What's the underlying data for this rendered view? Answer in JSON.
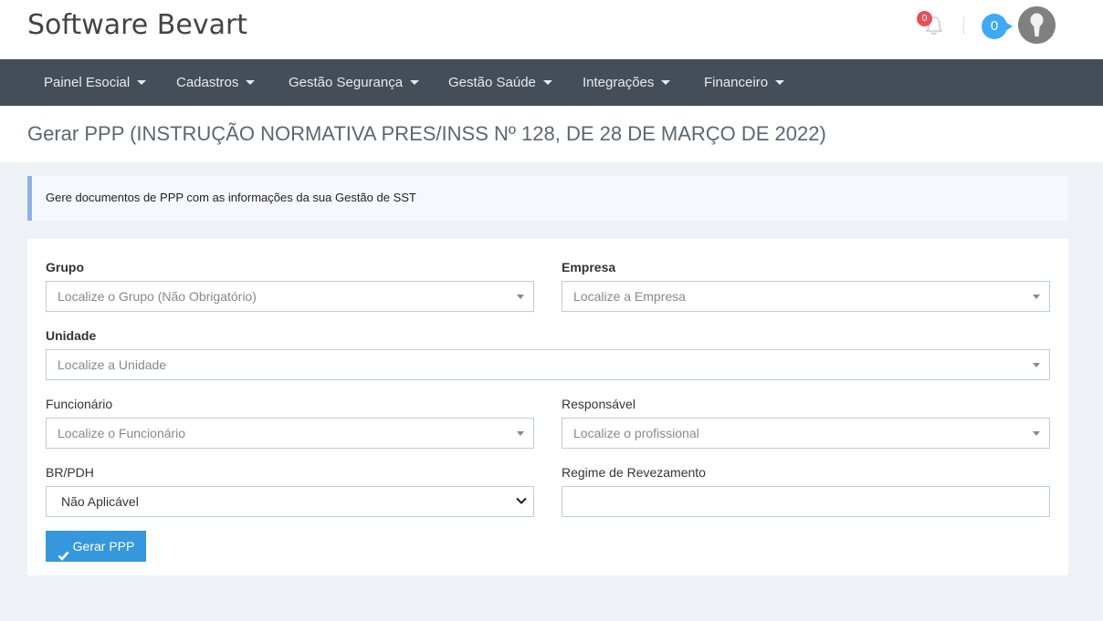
{
  "header": {
    "brand": "Software Bevart",
    "notifications_count": "0",
    "messages_count": "0"
  },
  "nav": {
    "items": [
      {
        "label": "Painel Esocial"
      },
      {
        "label": "Cadastros"
      },
      {
        "label": "Gestão Segurança"
      },
      {
        "label": "Gestão Saúde"
      },
      {
        "label": "Integrações"
      },
      {
        "label": "Financeiro"
      }
    ]
  },
  "page": {
    "title": "Gerar PPP (INSTRUÇÃO NORMATIVA PRES/INSS Nº 128, DE 28 DE MARÇO DE 2022)",
    "note": "Gere documentos de PPP com as informações da sua Gestão de SST"
  },
  "form": {
    "grupo": {
      "label": "Grupo",
      "placeholder": "Localize o Grupo (Não Obrigatório)"
    },
    "empresa": {
      "label": "Empresa",
      "placeholder": "Localize a Empresa"
    },
    "unidade": {
      "label": "Unidade",
      "placeholder": "Localize a Unidade"
    },
    "funcionario": {
      "label": "Funcionário",
      "placeholder": "Localize o Funcionário"
    },
    "responsavel": {
      "label": "Responsável",
      "placeholder": "Localize o profissional"
    },
    "br_pdh": {
      "label": "BR/PDH",
      "value": "Não Aplicável"
    },
    "regime": {
      "label": "Regime de Revezamento",
      "value": ""
    },
    "submit_label": "Gerar PPP"
  },
  "colors": {
    "navbar": "#444d58",
    "primary_button": "#3598dc",
    "notification_badge": "#e7505a",
    "message_badge": "#3fa9f5",
    "note_border": "#8fb3e3"
  },
  "icons": {
    "bell": "bell-icon",
    "avatar": "user-avatar-icon",
    "dropdown": "caret-down-icon",
    "check": "check-icon"
  }
}
